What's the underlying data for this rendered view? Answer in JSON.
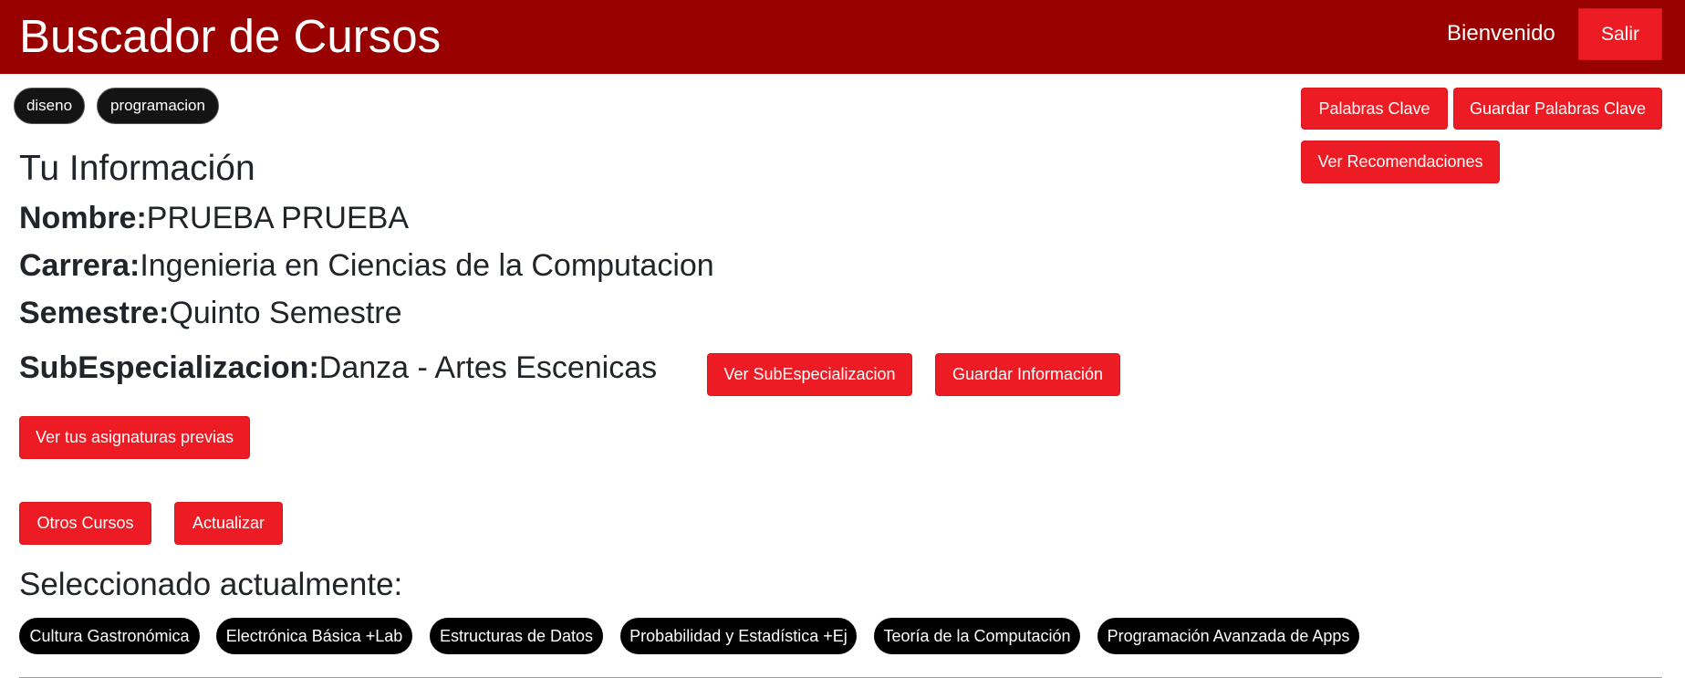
{
  "header": {
    "title": "Buscador de Cursos",
    "welcome": "Bienvenido",
    "logout_label": "Salir"
  },
  "keywords": [
    "diseno",
    "programacion"
  ],
  "actions": {
    "keywords_label": "Palabras Clave",
    "save_keywords_label": "Guardar Palabras Clave",
    "recommendations_label": "Ver Recomendaciones"
  },
  "info": {
    "heading": "Tu Información",
    "name_label": "Nombre:",
    "name_value": "PRUEBA PRUEBA",
    "career_label": "Carrera:",
    "career_value": "Ingenieria en Ciencias de la Computacion",
    "semester_label": "Semestre:",
    "semester_value": "Quinto Semestre",
    "subspec_label": "SubEspecializacion:",
    "subspec_value": "Danza - Artes Escenicas",
    "view_subspec_label": "Ver SubEspecializacion",
    "save_info_label": "Guardar Información",
    "previous_courses_label": "Ver tus asignaturas previas"
  },
  "courses": {
    "other_label": "Otros Cursos",
    "refresh_label": "Actualizar",
    "selected_heading": "Seleccionado actualmente:",
    "selected": [
      "Cultura Gastronómica",
      "Electrónica Básica +Lab",
      "Estructuras de Datos",
      "Probabilidad y Estadística +Ej",
      "Teoría de la Computación",
      "Programación Avanzada de Apps"
    ]
  },
  "colors": {
    "navbar": "#990000",
    "button": "#ed1c24",
    "chip": "#000000"
  }
}
